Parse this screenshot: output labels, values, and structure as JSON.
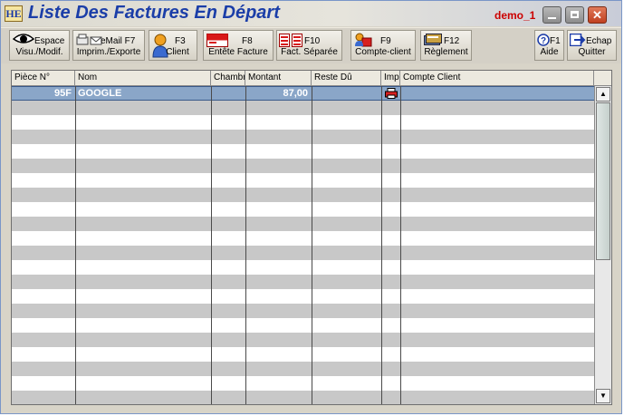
{
  "window": {
    "app_icon": "HE",
    "title": "Liste Des Factures En Départ",
    "user": "demo_1",
    "controls": {
      "minimize_icon": "minimize-icon",
      "maximize_icon": "maximize-icon",
      "close_glyph": "✕"
    }
  },
  "toolbar": {
    "visu": {
      "key": "Espace",
      "label": "Visu./Modif.",
      "icon": "eye-icon"
    },
    "imprim": {
      "key": "eMail  F7",
      "label": "Imprim./Exporte",
      "icon": "print-email-icon"
    },
    "client": {
      "key": "F3",
      "label": "Client",
      "icon": "client-icon"
    },
    "entete": {
      "key": "F8",
      "label": "Entête Facture",
      "icon": "invoice-header-icon"
    },
    "fact_sep": {
      "key": "F10",
      "label": "Fact. Séparée",
      "icon": "separate-invoice-icon"
    },
    "compte": {
      "key": "F9",
      "label": "Compte-client",
      "icon": "client-account-icon"
    },
    "reglement": {
      "key": "F12",
      "label": "Règlement",
      "icon": "payment-icon"
    },
    "aide": {
      "key": "F1",
      "label": "Aide",
      "icon": "help-icon"
    },
    "quitter": {
      "key": "Echap",
      "label": "Quitter",
      "icon": "exit-icon"
    }
  },
  "table": {
    "columns": [
      "Pièce N°",
      "Nom",
      "Chambre",
      "Montant",
      "Reste Dû",
      "Imp",
      "Compte Client"
    ],
    "rows": [
      {
        "piece": "95F",
        "nom": "GOOGLE",
        "chambre": "",
        "montant": "87,00",
        "reste_du": "",
        "imp": "printer-icon",
        "compte_client": ""
      }
    ]
  },
  "colors": {
    "title": "#1b3ea8",
    "user": "#cc0000",
    "selected_row": "#8aa6c8",
    "stripe": "#c8c8c8"
  }
}
